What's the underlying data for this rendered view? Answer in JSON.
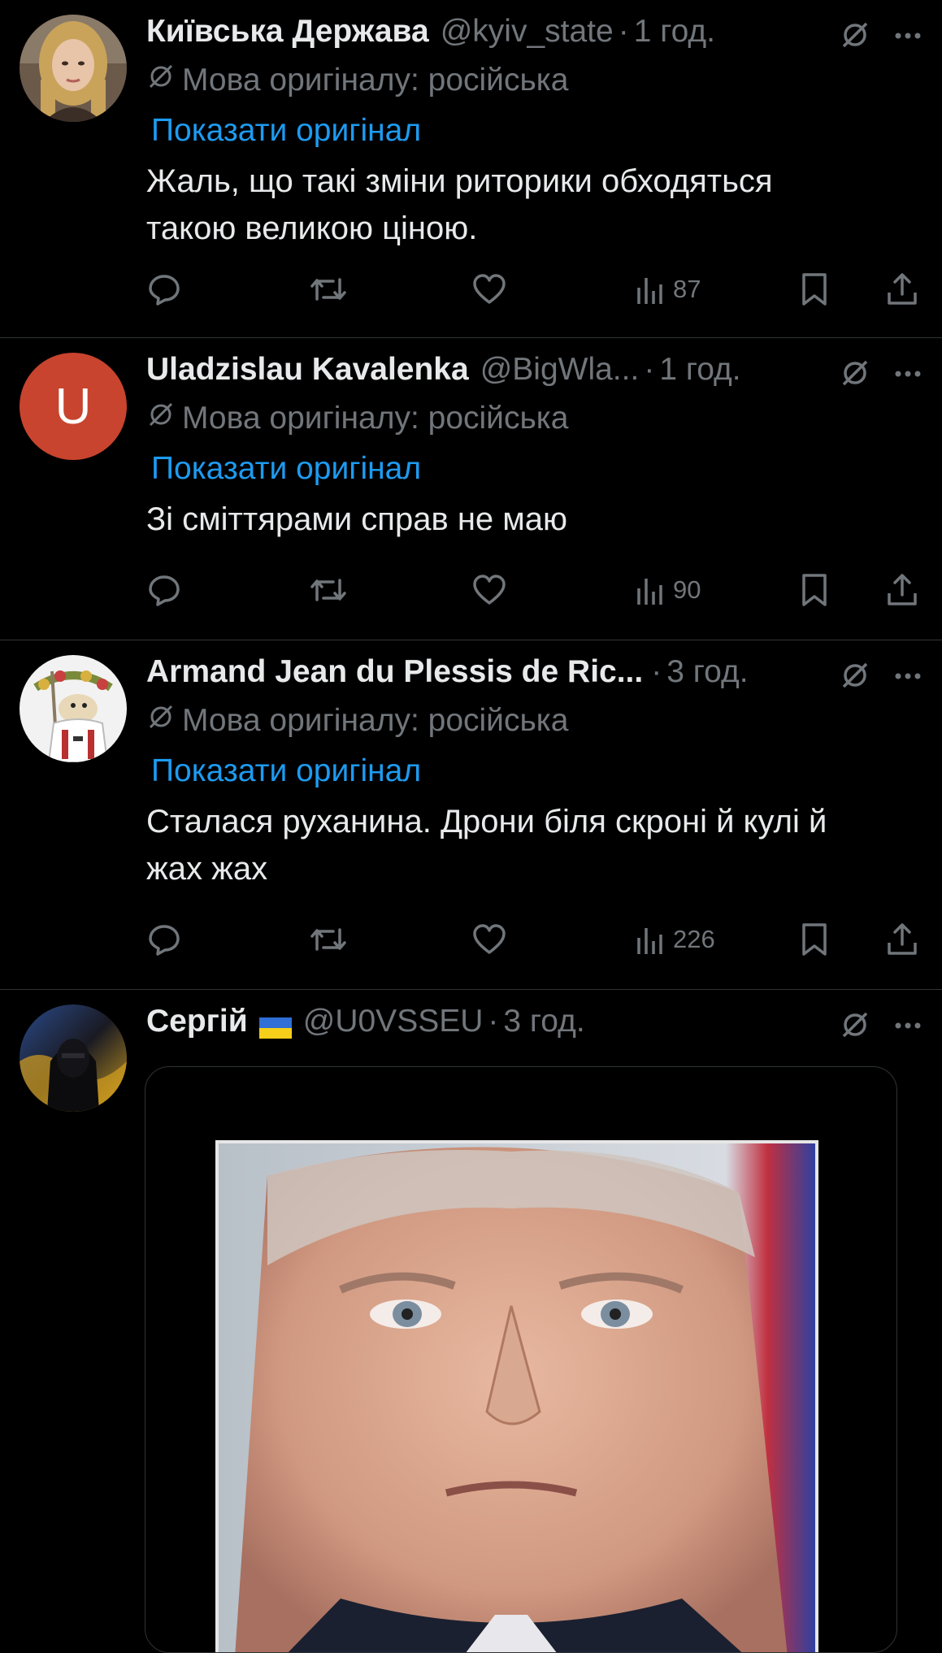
{
  "tweets": [
    {
      "name": "Київська Держава",
      "handle": "@kyiv_state",
      "time": "1 год.",
      "lang_note": "Мова оригіналу: російська",
      "show_original": "Показати оригінал",
      "text": "Жаль, що такі зміни риторики обходяться\nтакою великою ціною.",
      "views": "87"
    },
    {
      "name": "Uladzislau Kavalenka",
      "handle": "@BigWla...",
      "time": "1 год.",
      "avatar_letter": "U",
      "avatar_color": "#c8442e",
      "lang_note": "Мова оригіналу: російська",
      "show_original": "Показати оригінал",
      "text": "Зі сміттярами справ не маю",
      "views": "90"
    },
    {
      "name": "Armand Jean du Plessis de Ric...",
      "time": "3 год.",
      "lang_note": "Мова оригіналу: російська",
      "show_original": "Показати оригінал",
      "text": "Сталася руханина. Дрони біля скроні й кулі й\nжах жах",
      "views": "226"
    },
    {
      "name": "Сергій",
      "handle": "@U0VSSEU",
      "time": "3 год."
    }
  ],
  "separator": "·",
  "colors": {
    "background": "#000000",
    "text": "#e7e9ea",
    "secondary": "#71767b",
    "link": "#1d9bf0",
    "divider": "#2f3336"
  },
  "icons": {
    "reply": "reply-icon",
    "retweet": "retweet-icon",
    "like": "heart-icon",
    "views": "views-icon",
    "bookmark": "bookmark-icon",
    "share": "share-icon",
    "grok": "grok-icon",
    "more": "more-icon"
  }
}
